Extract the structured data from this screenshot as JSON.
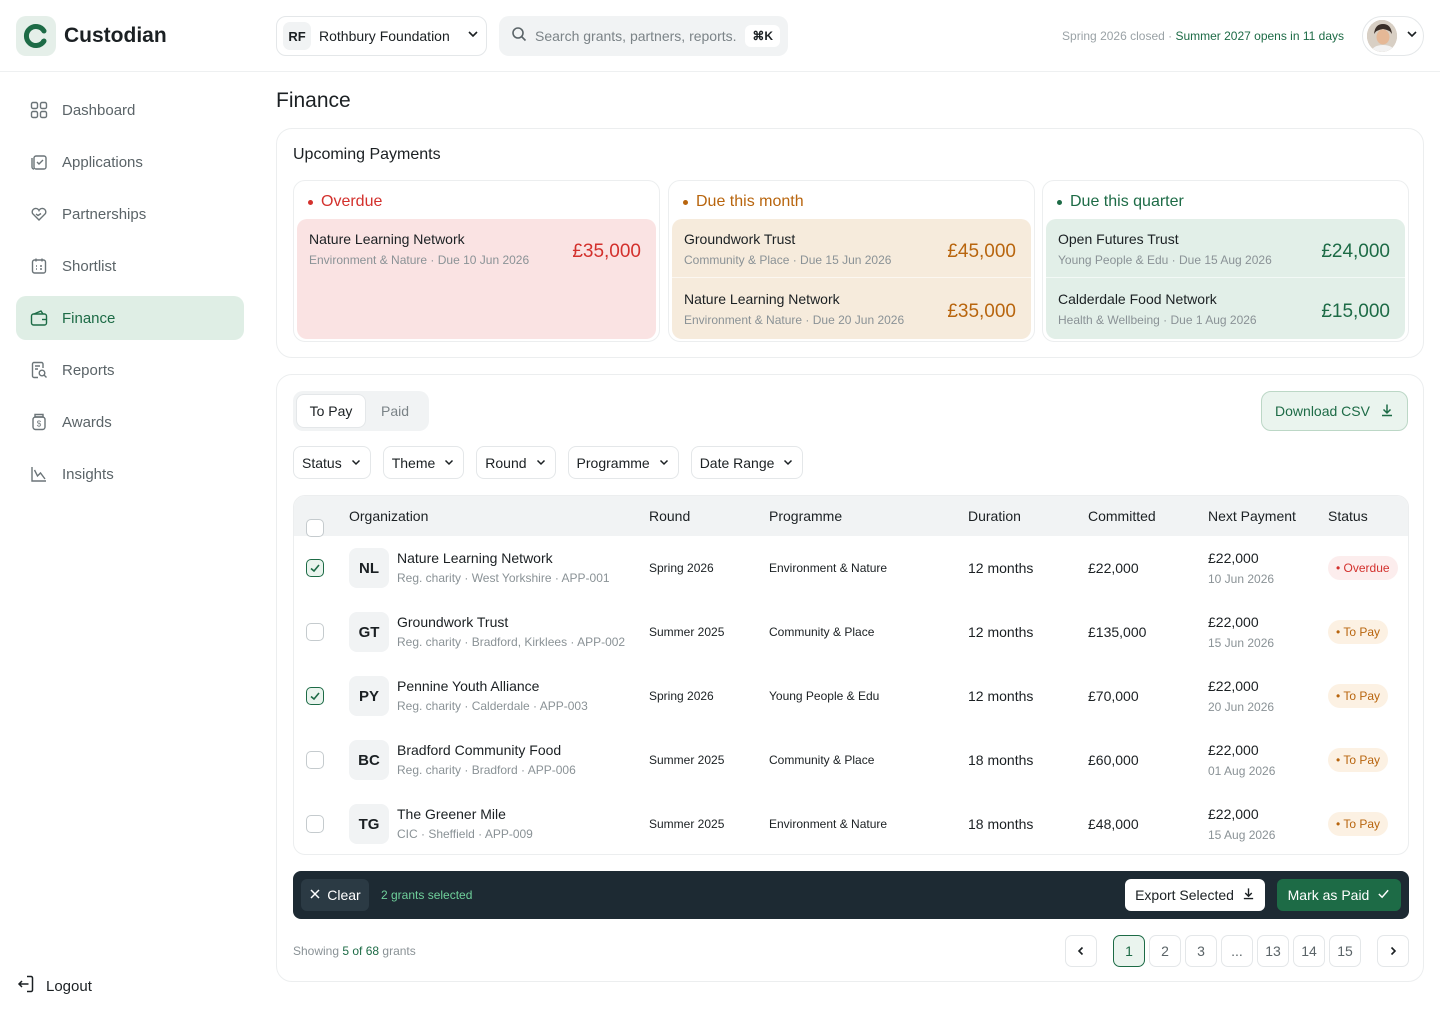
{
  "app": {
    "name": "Custodian"
  },
  "sidebar": {
    "items": [
      {
        "label": "Dashboard"
      },
      {
        "label": "Applications"
      },
      {
        "label": "Partnerships"
      },
      {
        "label": "Shortlist"
      },
      {
        "label": "Finance"
      },
      {
        "label": "Reports"
      },
      {
        "label": "Awards"
      },
      {
        "label": "Insights"
      }
    ],
    "logout": "Logout"
  },
  "header": {
    "org_initials": "RF",
    "org_name": "Rothbury Foundation",
    "search_placeholder": "Search grants, partners, reports...",
    "search_shortcut": "⌘K",
    "season_closed": "Spring 2026 closed · ",
    "season_opens": "Summer 2027 opens in 11 days"
  },
  "page": {
    "title": "Finance"
  },
  "upcoming": {
    "title": "Upcoming Payments",
    "columns": [
      {
        "title": "Overdue",
        "color": "#d3312d",
        "bg": "#fae3e3",
        "payments": [
          {
            "name": "Nature Learning Network",
            "theme": "Environment & Nature",
            "due": "Due 10 Jun 2026",
            "amount": "£35,000"
          }
        ]
      },
      {
        "title": "Due this month",
        "color": "#b8650e",
        "bg": "#f6ebdc",
        "payments": [
          {
            "name": "Groundwork Trust",
            "theme": "Community & Place",
            "due": "Due 15 Jun 2026",
            "amount": "£45,000"
          },
          {
            "name": "Nature Learning Network",
            "theme": "Environment & Nature",
            "due": "Due 20 Jun 2026",
            "amount": "£35,000"
          }
        ]
      },
      {
        "title": "Due this quarter",
        "color": "#1d6b46",
        "bg": "#e2efe8",
        "payments": [
          {
            "name": "Open Futures Trust",
            "theme": "Young People & Edu",
            "due": "Due 15 Aug 2026",
            "amount": "£24,000"
          },
          {
            "name": "Calderdale Food Network",
            "theme": "Health & Wellbeing",
            "due": "Due 1 Aug 2026",
            "amount": "£15,000"
          }
        ]
      }
    ]
  },
  "tabs": {
    "to_pay": "To Pay",
    "paid": "Paid"
  },
  "download_label": "Download CSV",
  "filters": [
    {
      "label": "Status"
    },
    {
      "label": "Theme"
    },
    {
      "label": "Round"
    },
    {
      "label": "Programme"
    },
    {
      "label": "Date Range"
    }
  ],
  "table": {
    "headers": {
      "organization": "Organization",
      "round": "Round",
      "programme": "Programme",
      "duration": "Duration",
      "committed": "Committed",
      "next_payment": "Next Payment",
      "status": "Status"
    },
    "rows": [
      {
        "checked": true,
        "initials": "NL",
        "name": "Nature Learning Network",
        "meta": "Reg. charity · West Yorkshire · APP-001",
        "round": "Spring 2026",
        "programme": "Environment & Nature",
        "duration": "12 months",
        "committed": "£22,000",
        "next_amount": "£22,000",
        "next_date": "10 Jun 2026",
        "status": "• Overdue",
        "status_kind": "overdue"
      },
      {
        "checked": false,
        "initials": "GT",
        "name": "Groundwork Trust",
        "meta": "Reg. charity · Bradford, Kirklees · APP-002",
        "round": "Summer 2025",
        "programme": "Community & Place",
        "duration": "12 months",
        "committed": "£135,000",
        "next_amount": "£22,000",
        "next_date": "15 Jun 2026",
        "status": "• To Pay",
        "status_kind": "topay"
      },
      {
        "checked": true,
        "initials": "PY",
        "name": "Pennine Youth Alliance",
        "meta": "Reg. charity · Calderdale · APP-003",
        "round": "Spring 2026",
        "programme": "Young People & Edu",
        "duration": "12 months",
        "committed": "£70,000",
        "next_amount": "£22,000",
        "next_date": "20 Jun 2026",
        "status": "• To Pay",
        "status_kind": "topay"
      },
      {
        "checked": false,
        "initials": "BC",
        "name": "Bradford Community Food",
        "meta": "Reg. charity · Bradford · APP-006",
        "round": "Summer 2025",
        "programme": "Community & Place",
        "duration": "18 months",
        "committed": "£60,000",
        "next_amount": "£22,000",
        "next_date": "01 Aug 2026",
        "status": "• To Pay",
        "status_kind": "topay"
      },
      {
        "checked": false,
        "initials": "TG",
        "name": "The Greener Mile",
        "meta": "CIC · Sheffield · APP-009",
        "round": "Summer 2025",
        "programme": "Environment & Nature",
        "duration": "18 months",
        "committed": "£48,000",
        "next_amount": "£22,000",
        "next_date": "15 Aug 2026",
        "status": "• To Pay",
        "status_kind": "topay"
      }
    ]
  },
  "actionbar": {
    "clear": "Clear",
    "selected": "2 grants selected",
    "export": "Export Selected",
    "mark_paid": "Mark as Paid"
  },
  "footer": {
    "showing_prefix": "Showing ",
    "showing_count": "5 of 68",
    "showing_suffix": " grants"
  },
  "pagination": {
    "pages": [
      "1",
      "2",
      "3",
      "...",
      "13",
      "14",
      "15"
    ],
    "current": "1"
  }
}
